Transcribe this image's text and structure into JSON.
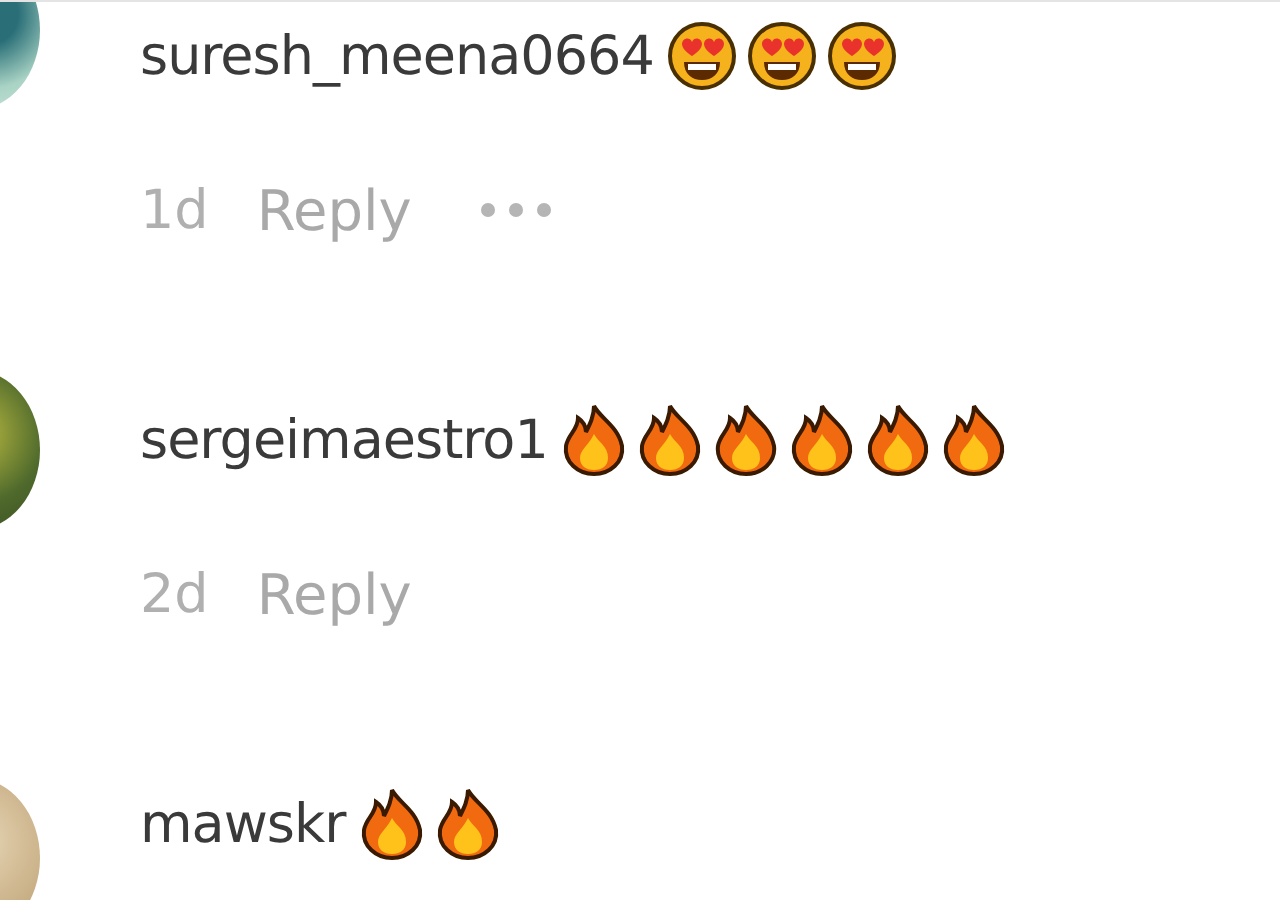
{
  "comments": [
    {
      "username": "suresh_meena0664",
      "emojis": [
        {
          "kind": "heart_eyes"
        },
        {
          "kind": "heart_eyes"
        },
        {
          "kind": "heart_eyes"
        }
      ],
      "time": "1d",
      "reply": "Reply",
      "more": true
    },
    {
      "username": "sergeimaestro1",
      "emojis": [
        {
          "kind": "fire"
        },
        {
          "kind": "fire"
        },
        {
          "kind": "fire"
        },
        {
          "kind": "fire"
        },
        {
          "kind": "fire"
        },
        {
          "kind": "fire"
        }
      ],
      "time": "2d",
      "reply": "Reply",
      "more": false
    },
    {
      "username": "mawskr",
      "emojis": [
        {
          "kind": "fire"
        },
        {
          "kind": "fire"
        }
      ]
    }
  ]
}
